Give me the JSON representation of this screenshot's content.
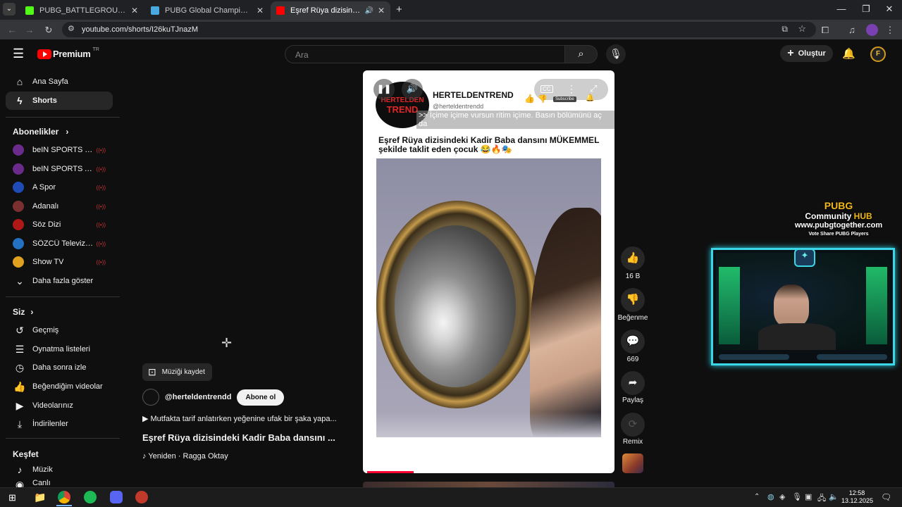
{
  "browser": {
    "tabs": [
      {
        "title": "PUBG_BATTLEGROUNDSTR Stre"
      },
      {
        "title": "PUBG Global Championship 20"
      },
      {
        "title": "Eşref Rüya dizisindeki Kadir"
      }
    ],
    "url": "youtube.com/shorts/I26kuTJnazM"
  },
  "header": {
    "logo": "Premium",
    "logo_sup": "TR",
    "search_placeholder": "Ara",
    "create_label": "Oluştur"
  },
  "sidebar": {
    "main": [
      {
        "label": "Ana Sayfa",
        "icon": "home-icon"
      },
      {
        "label": "Shorts",
        "icon": "shorts-icon"
      }
    ],
    "subs_title": "Abonelikler",
    "subs": [
      {
        "label": "beIN SPORTS Tü...",
        "color": "#6a2b8a"
      },
      {
        "label": "beIN SPORTS Ar...",
        "color": "#6a2b8a"
      },
      {
        "label": "A Spor",
        "color": "#1e4bb5"
      },
      {
        "label": "Adanalı",
        "color": "#7a3030"
      },
      {
        "label": "Söz Dizi",
        "color": "#b01818"
      },
      {
        "label": "SÖZCÜ Televizyo...",
        "color": "#2470c2"
      },
      {
        "label": "Show TV",
        "color": "#e0a020"
      }
    ],
    "more_label": "Daha fazla göster",
    "you_title": "Siz",
    "you": [
      {
        "label": "Geçmiş",
        "icon": "history-icon"
      },
      {
        "label": "Oynatma listeleri",
        "icon": "playlist-icon"
      },
      {
        "label": "Daha sonra izle",
        "icon": "clock-icon"
      },
      {
        "label": "Beğendiğim videolar",
        "icon": "like-icon"
      },
      {
        "label": "Videolarınız",
        "icon": "video-icon"
      },
      {
        "label": "İndirilenler",
        "icon": "download-icon"
      }
    ],
    "explore_title": "Keşfet",
    "explore": [
      {
        "label": "Müzik",
        "icon": "music-icon"
      },
      {
        "label": "Canlı",
        "icon": "live-icon"
      }
    ]
  },
  "short_info": {
    "save_music": "Müziği kaydet",
    "channel": "@herteldentrendd",
    "subscribe": "Abone ol",
    "description": "Mutfakta tarif anlatırken yeğenine ufak bir şaka yapa...",
    "title": "Eşref Rüya dizisindeki Kadir Baba dansını ...",
    "music": "Yeniden · Ragga Oktay"
  },
  "player": {
    "channel_name": "HERTELDENTREND",
    "handle": "@herteldentrendd",
    "logo_text_1": "HERTELDEN",
    "logo_text_2": "TREND",
    "caption": ">> İçime içime vursun ritim içime. Basın bölümünü aç da",
    "overlay_title": "Eşref Rüya dizisindeki Kadir Baba dansını MÜKEMMEL şekilde taklit eden çocuk 😂🔥🎭",
    "subscribe_mini": "Subscribe",
    "cc": "CC"
  },
  "actions": {
    "likes": "16 B",
    "dislike": "Beğenme",
    "comments": "669",
    "share": "Paylaş",
    "remix": "Remix"
  },
  "stream_overlay": {
    "line1": "PUBG",
    "line2a": "Community ",
    "line2b": "HUB",
    "line3": "www.pubgtogether.com",
    "line4": "Vote  Share  PUBG  Players"
  },
  "taskbar": {
    "time": "12:58",
    "date": "13.12.2025"
  }
}
